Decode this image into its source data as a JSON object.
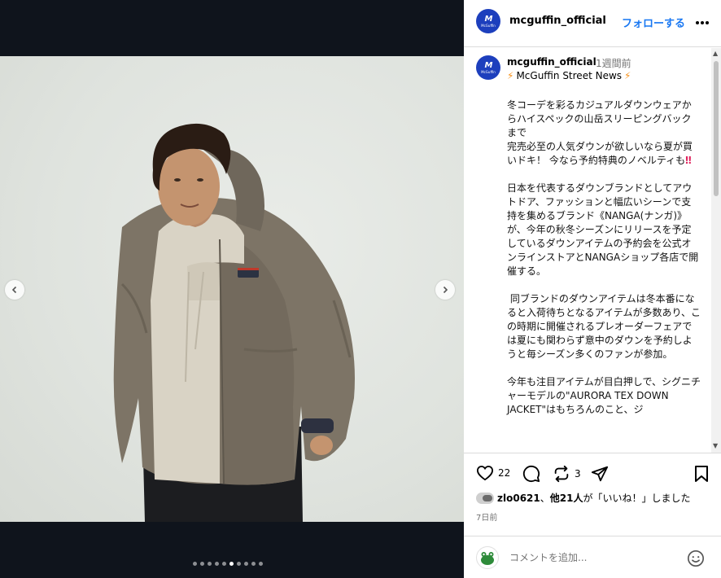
{
  "media": {
    "nav_prev_icon": "chevron-left-icon",
    "nav_next_icon": "chevron-right-icon",
    "carousel": {
      "count": 10,
      "active_index": 5
    }
  },
  "header": {
    "username": "mcguffin_official",
    "follow_label": "フォローする",
    "more_icon": "more-horizontal-icon",
    "avatar_text": "M",
    "avatar_subtext": "McGuffin"
  },
  "caption": {
    "username": "mcguffin_official",
    "time": "1週間前",
    "news_title": "McGuffin Street News",
    "paragraphs": [
      "冬コーデを彩るカジュアルダウンウェアからハイスペックの山岳スリーピングバックまで\n完売必至の人気ダウンが欲しいなら夏が買いドキ！ 今なら予約特典のノベルティも",
      "日本を代表するダウンブランドとしてアウトドア、ファッションと幅広いシーンで支持を集めるブランド《NANGA(ナンガ)》が、今年の秋冬シーズンにリリースを予定しているダウンアイテムの予約会を公式オンラインストアとNANGAショップ各店で開催する。",
      " 同ブランドのダウンアイテムは冬本番になると入荷待ちとなるアイテムが多数あり、この時期に開催されるプレオーダーフェアでは夏にも関わらず意中のダウンを予約しようと毎シーズン多くのファンが参加。",
      "今年も注目アイテムが目白押しで、シグニチャーモデルの\"AURORA TEX DOWN JACKET\"はもちろんのこと、ジ"
    ],
    "double_exclamation": "‼"
  },
  "actions": {
    "like_count": "22",
    "repost_count": "3"
  },
  "likes": {
    "user": "zlo0621",
    "others": "他21人",
    "suffix": "が「いいね！」しました"
  },
  "date": "7日前",
  "comment": {
    "placeholder": "コメントを追加..."
  },
  "colors": {
    "accent": "#1877f2",
    "avatar_blue": "#1d3fbd",
    "media_bg": "#0f141c"
  }
}
